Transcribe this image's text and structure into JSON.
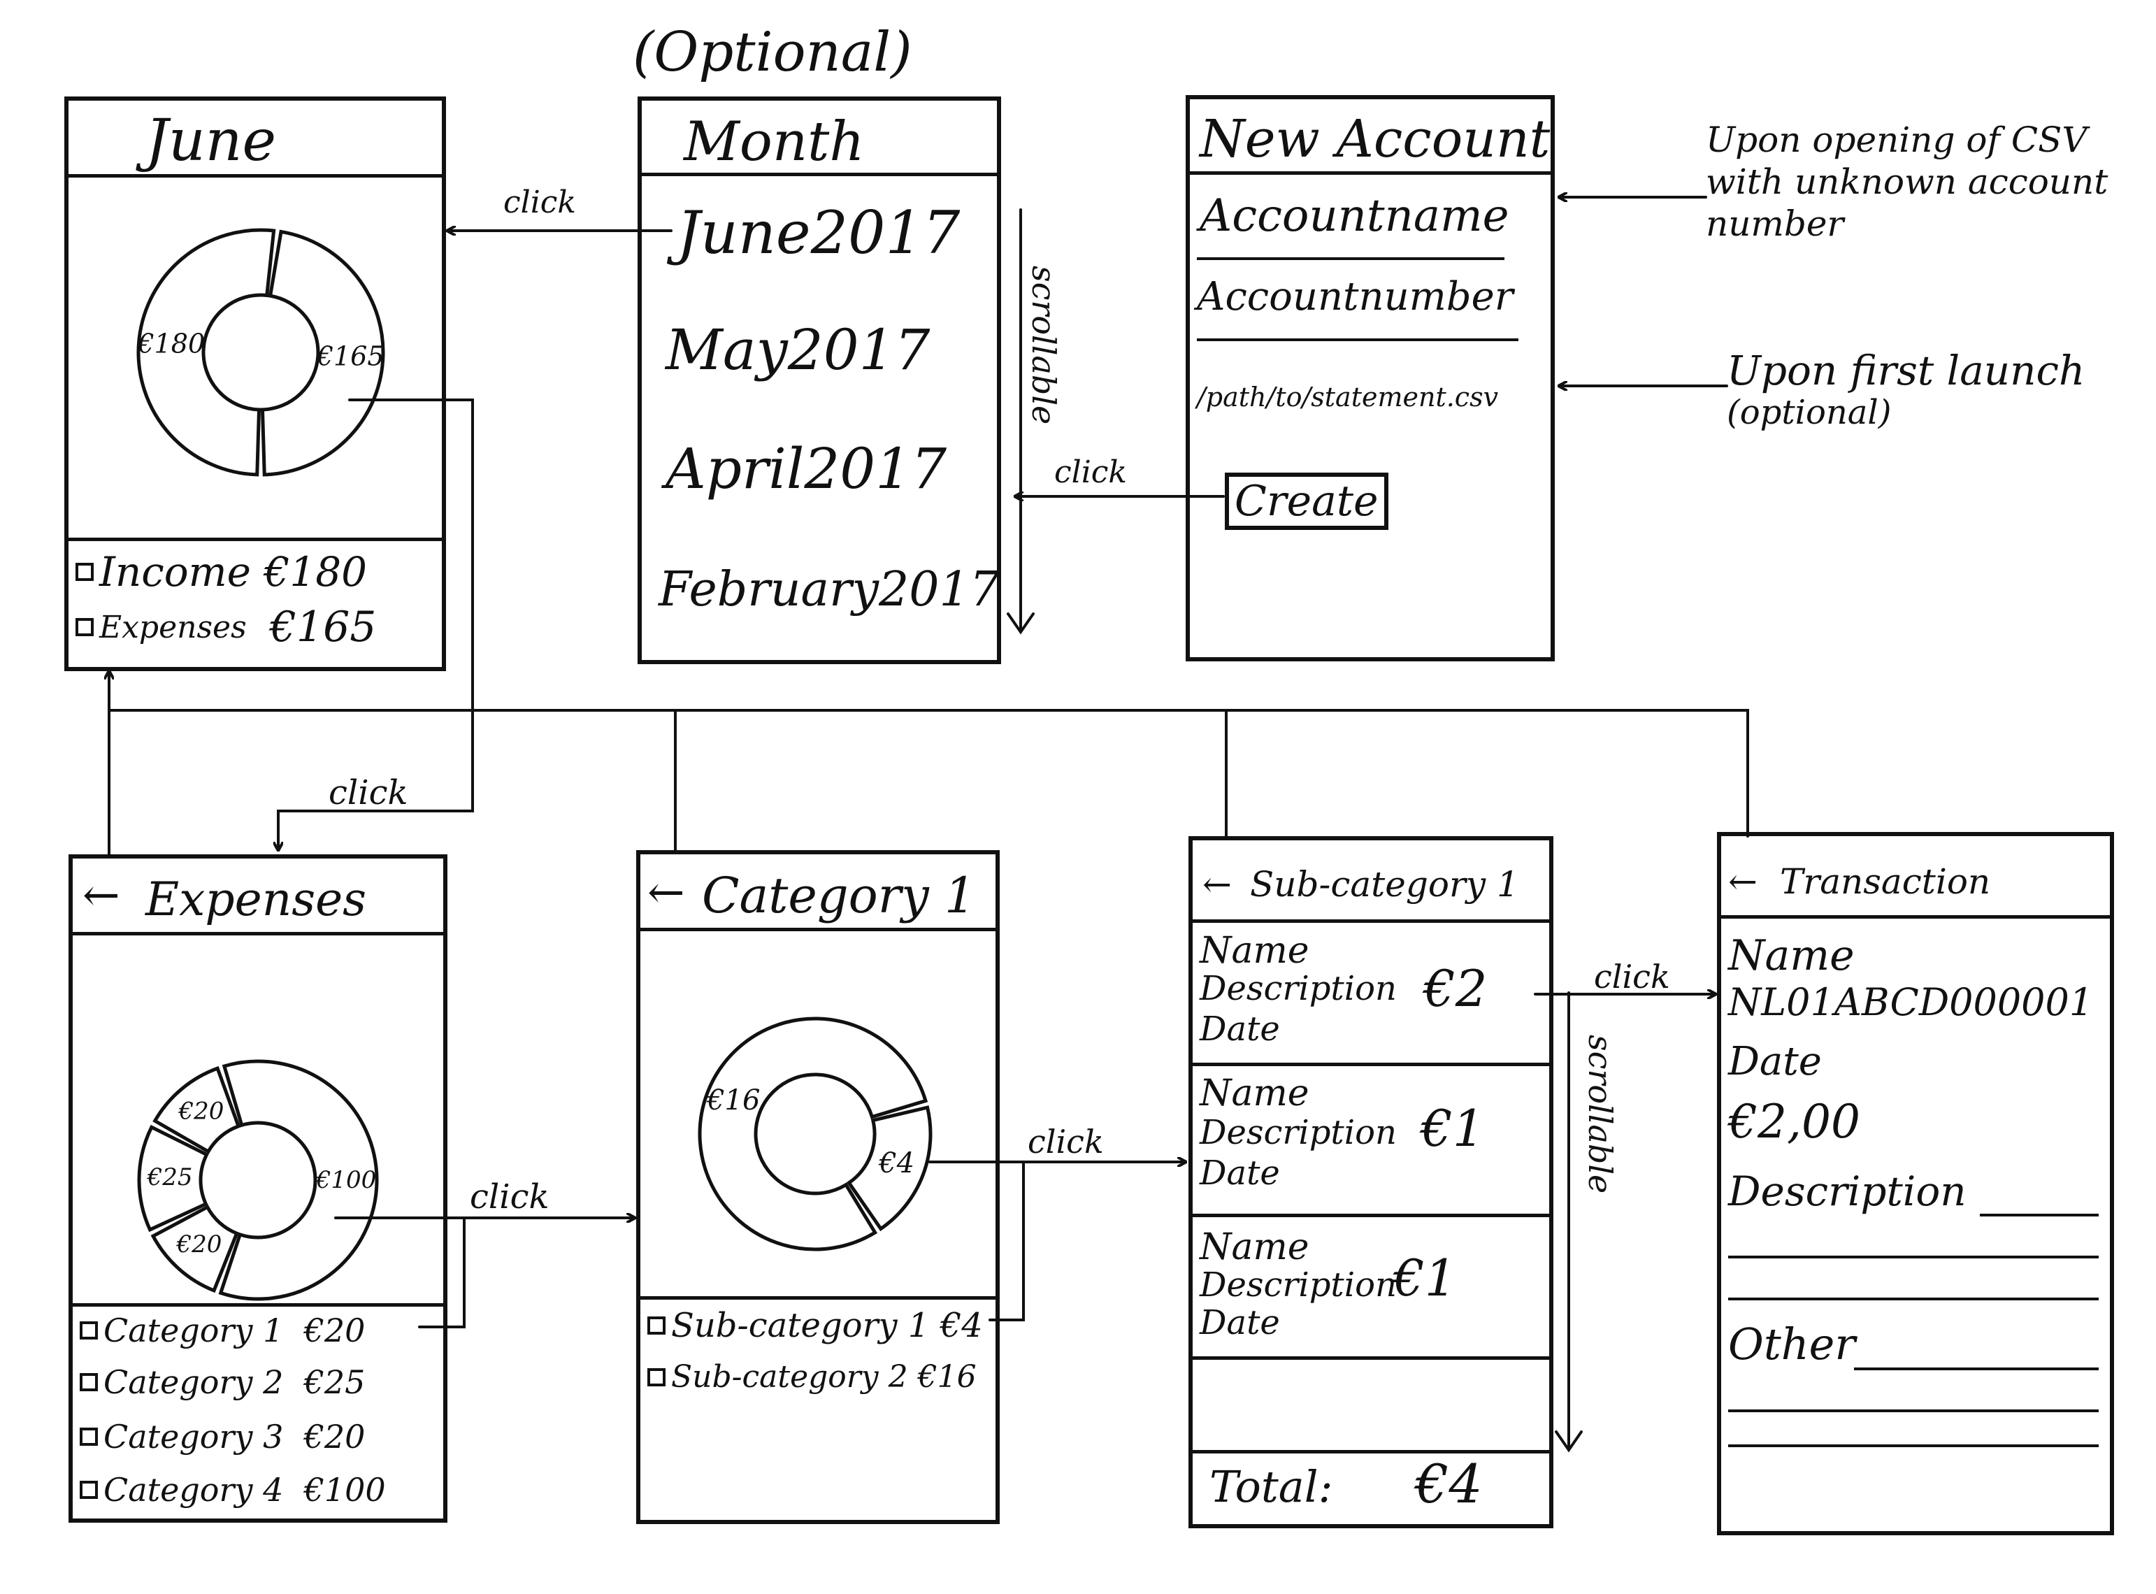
{
  "optional_note": "(Optional)",
  "month_summary": {
    "title": "June",
    "chart_data": {
      "type": "pie",
      "categories": [
        "Income",
        "Expenses"
      ],
      "values": [
        180,
        165
      ],
      "labels": [
        "€180",
        "€165"
      ]
    },
    "legend": [
      {
        "label": "Income",
        "value": "€180"
      },
      {
        "label": "Expenses",
        "value": "€165"
      }
    ]
  },
  "month_list": {
    "title": "Month",
    "items": [
      "June2017",
      "May2017",
      "April2017",
      "February2017"
    ],
    "scroll_note": "scrollable"
  },
  "new_account": {
    "title": "New Account",
    "account_name": "Accountname",
    "account_number": "Accountnumber",
    "path": "/path/to/statement.csv",
    "create_button": "Create",
    "note_csv": [
      "Upon opening of CSV",
      "with unknown account",
      "number"
    ],
    "note_first_launch": [
      "Upon first launch",
      "(optional)"
    ]
  },
  "expenses": {
    "back_icon": "arrow-left-icon",
    "title": "Expenses",
    "chart_data": {
      "type": "pie",
      "categories": [
        "Category 1",
        "Category 2",
        "Category 3",
        "Category 4"
      ],
      "values": [
        20,
        25,
        20,
        100
      ],
      "labels": [
        "€20",
        "€25",
        "€20",
        "€100"
      ]
    },
    "legend": [
      {
        "label": "Category 1",
        "value": "€20"
      },
      {
        "label": "Category 2",
        "value": "€25"
      },
      {
        "label": "Category 3",
        "value": "€20"
      },
      {
        "label": "Category 4",
        "value": "€100"
      }
    ]
  },
  "category": {
    "title": "Category 1",
    "chart_data": {
      "type": "pie",
      "categories": [
        "Sub-category 1",
        "Sub-category 2"
      ],
      "values": [
        4,
        16
      ],
      "labels": [
        "€4",
        "€16"
      ]
    },
    "legend": [
      {
        "label": "Sub-category 1",
        "value": "€4"
      },
      {
        "label": "Sub-category 2",
        "value": "€16"
      }
    ]
  },
  "subcategory": {
    "title": "Sub-category 1",
    "rows": [
      {
        "name": "Name",
        "description": "Description",
        "date": "Date",
        "amount": "€2"
      },
      {
        "name": "Name",
        "description": "Description",
        "date": "Date",
        "amount": "€1"
      },
      {
        "name": "Name",
        "description": "Description",
        "date": "Date",
        "amount": "€1"
      }
    ],
    "total_label": "Total:",
    "total_value": "€4",
    "scroll_note": "scrollable"
  },
  "transaction": {
    "title": "Transaction",
    "name_label": "Name",
    "account": "NL01ABCD000001",
    "date_label": "Date",
    "amount": "€2,00",
    "description_label": "Description",
    "other_label": "Other"
  },
  "arrows": {
    "click": "click"
  },
  "colors": {
    "ink": "#111111",
    "paper": "#ffffff"
  }
}
